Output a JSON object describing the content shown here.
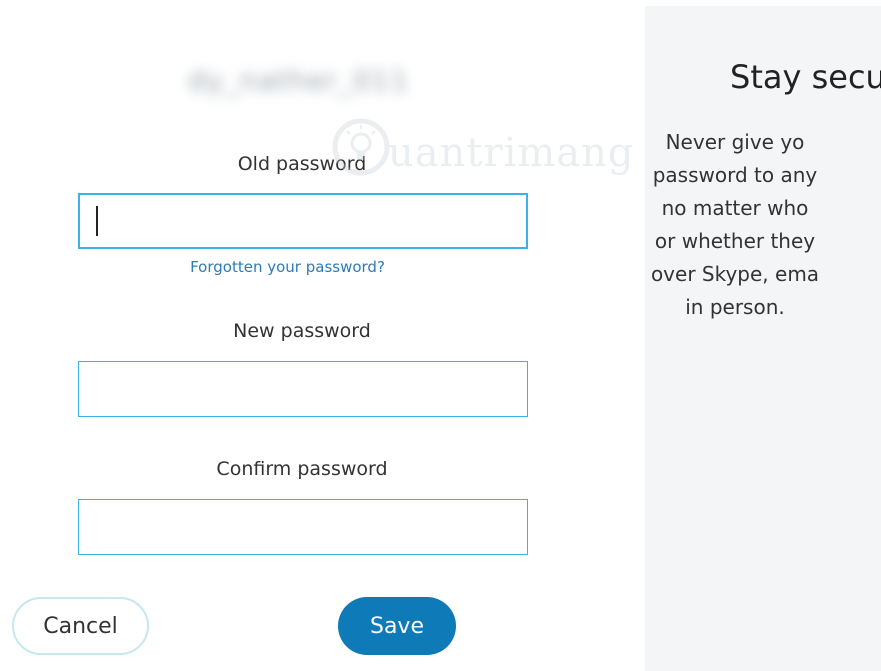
{
  "account": {
    "username_blurred": "dy_nather_011"
  },
  "form": {
    "old_password_label": "Old password",
    "old_password_value": "",
    "forgot_link": "Forgotten your password?",
    "new_password_label": "New password",
    "new_password_value": "",
    "confirm_password_label": "Confirm password",
    "confirm_password_value": ""
  },
  "buttons": {
    "cancel_label": "Cancel",
    "save_label": "Save"
  },
  "tips": {
    "title": "Stay secur",
    "lines": [
      "Never give yo",
      "password to any",
      "no matter who",
      "or whether they",
      "over Skype, ema",
      "in person."
    ]
  },
  "watermark": {
    "text": "uantrimang",
    "icon": "lightbulb-icon"
  },
  "colors": {
    "accent": "#3bb2e8",
    "primary_button": "#0e7ab7",
    "link": "#2d7bb6",
    "tip_panel_bg": "#f3f5f7"
  }
}
